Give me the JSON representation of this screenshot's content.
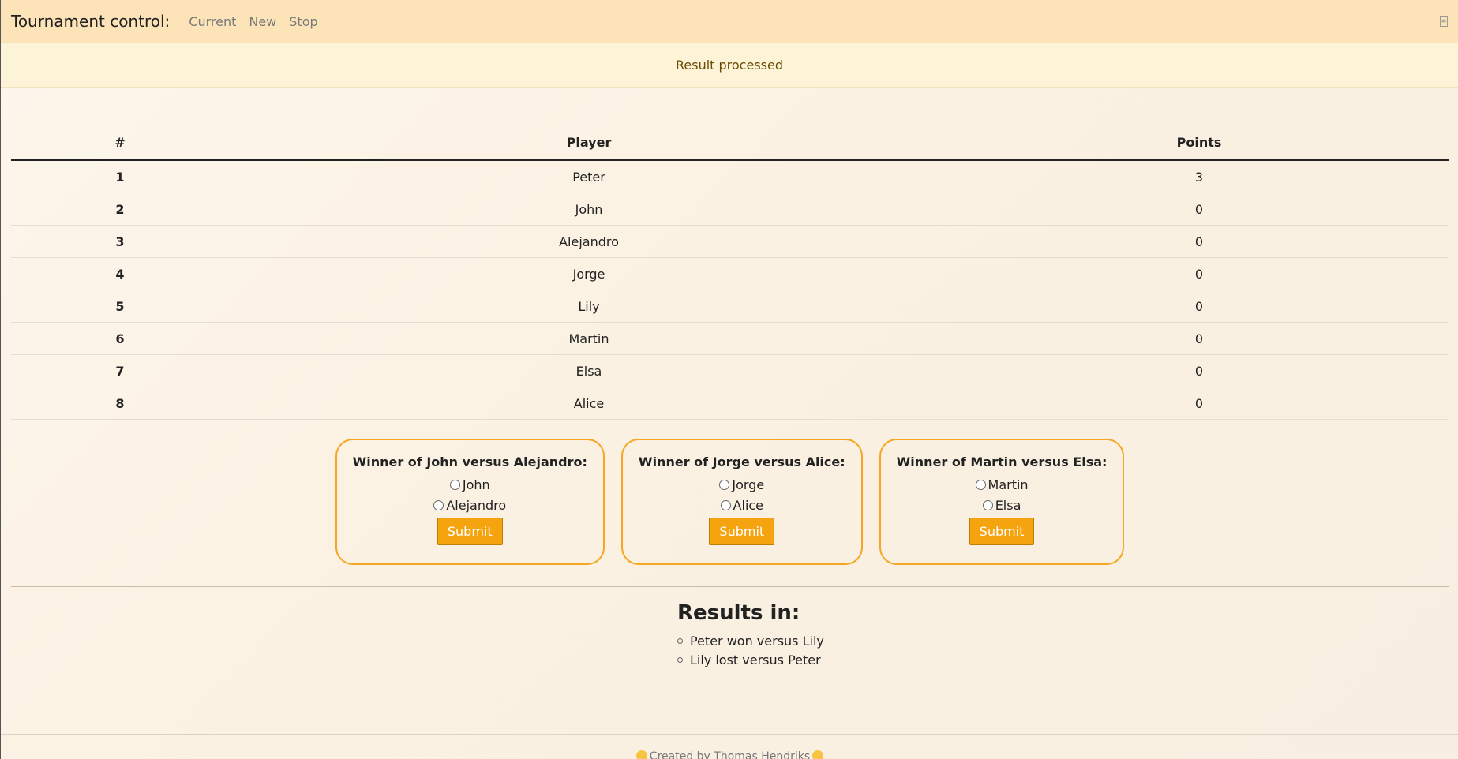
{
  "navbar": {
    "brand": "Tournament control:",
    "links": [
      "Current",
      "New",
      "Stop"
    ]
  },
  "alert": {
    "message": "Result processed"
  },
  "standings": {
    "headers": [
      "#",
      "Player",
      "Points"
    ],
    "rows": [
      {
        "rank": "1",
        "player": "Peter",
        "points": "3"
      },
      {
        "rank": "2",
        "player": "John",
        "points": "0"
      },
      {
        "rank": "3",
        "player": "Alejandro",
        "points": "0"
      },
      {
        "rank": "4",
        "player": "Jorge",
        "points": "0"
      },
      {
        "rank": "5",
        "player": "Lily",
        "points": "0"
      },
      {
        "rank": "6",
        "player": "Martin",
        "points": "0"
      },
      {
        "rank": "7",
        "player": "Elsa",
        "points": "0"
      },
      {
        "rank": "8",
        "player": "Alice",
        "points": "0"
      }
    ]
  },
  "matches": [
    {
      "title": "Winner of John versus Alejandro:",
      "options": [
        "John",
        "Alejandro"
      ],
      "submit_label": "Submit"
    },
    {
      "title": "Winner of Jorge versus Alice:",
      "options": [
        "Jorge",
        "Alice"
      ],
      "submit_label": "Submit"
    },
    {
      "title": "Winner of Martin versus Elsa:",
      "options": [
        "Martin",
        "Elsa"
      ],
      "submit_label": "Submit"
    }
  ],
  "results": {
    "title": "Results in:",
    "items": [
      "Peter won versus Lily",
      "Lily lost versus Peter"
    ]
  },
  "footer": {
    "text": "Created by Thomas Hendriks"
  },
  "colors": {
    "accent": "#f5a30f",
    "navbar_bg": "#fde4b8",
    "alert_bg": "#fdf3d6"
  }
}
